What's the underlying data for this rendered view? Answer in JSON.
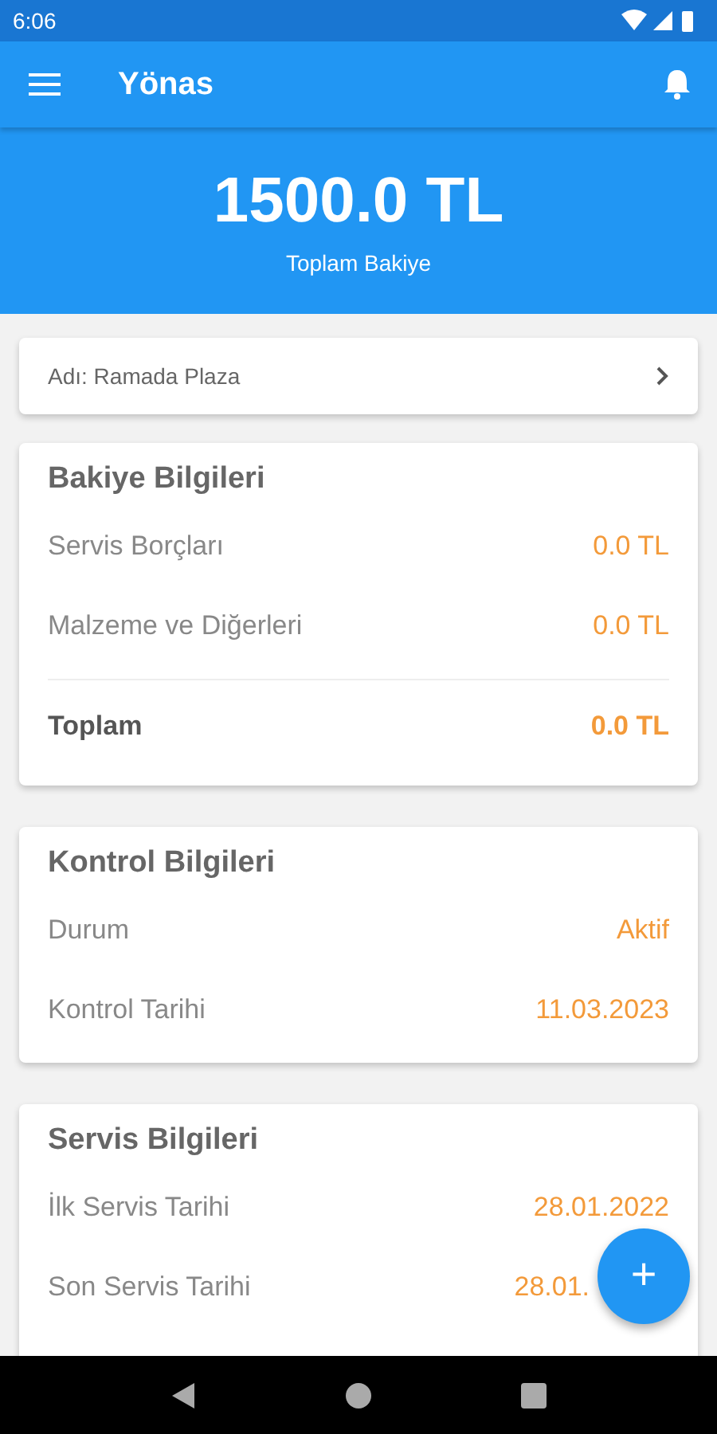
{
  "status_bar": {
    "time": "6:06"
  },
  "app_bar": {
    "title": "Yönas"
  },
  "balance": {
    "amount": "1500.0 TL",
    "label": "Toplam Bakiye"
  },
  "name_row": {
    "text": "Adı: Ramada Plaza"
  },
  "cards": [
    {
      "title": "Bakiye Bilgileri",
      "rows": [
        {
          "label": "Servis Borçları",
          "value": "0.0 TL",
          "kind": "item"
        },
        {
          "label": "Malzeme ve Diğerleri",
          "value": "0.0 TL",
          "kind": "item"
        },
        {
          "label": "Toplam",
          "value": "0.0 TL",
          "kind": "total"
        }
      ]
    },
    {
      "title": "Kontrol Bilgileri",
      "rows": [
        {
          "label": "Durum",
          "value": "Aktif",
          "kind": "item"
        },
        {
          "label": "Kontrol Tarihi",
          "value": "11.03.2023",
          "kind": "item"
        }
      ]
    },
    {
      "title": "Servis Bilgileri",
      "rows": [
        {
          "label": "İlk Servis Tarihi",
          "value": "28.01.2022",
          "kind": "item"
        },
        {
          "label": "Son Servis Tarihi",
          "value": "28.01.",
          "kind": "cut"
        }
      ]
    }
  ],
  "fab": {
    "symbol": "+"
  }
}
